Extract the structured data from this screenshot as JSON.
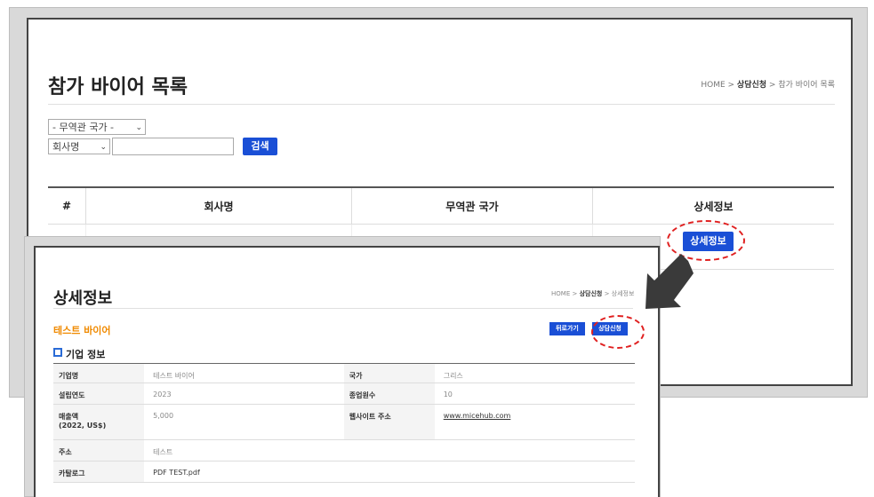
{
  "back": {
    "title": "참가 바이어 목록",
    "breadcrumb": {
      "home": "HOME",
      "sep1": " > ",
      "current": "상담신청",
      "sep2": " > ",
      "page": "참가 바이어 목록"
    },
    "filter": {
      "country_select": "- 무역관 국가 -",
      "field_select": "회사명",
      "search_value": "",
      "search_button": "검색"
    },
    "table": {
      "headers": [
        "#",
        "회사명",
        "무역관 국가",
        "상세정보"
      ],
      "row": {
        "detail_button": "상세정보"
      }
    }
  },
  "front": {
    "title": "상세정보",
    "breadcrumb": {
      "home": "HOME",
      "sep1": " > ",
      "current": "상담신청",
      "sep2": " > ",
      "page": "상세정보"
    },
    "buyer_name": "테스트 바이어",
    "back_button": "뒤로가기",
    "apply_button": "상담신청",
    "section_title": "기업 정보",
    "info": {
      "company_label": "기업명",
      "company_value": "테스트 바이어",
      "country_label": "국가",
      "country_value": "그리스",
      "founded_label": "설립연도",
      "founded_value": "2023",
      "employees_label": "종업원수",
      "employees_value": "10",
      "revenue_label": "매출액\n(2022, US$)",
      "revenue_value": "5,000",
      "website_label": "웹사이트 주소",
      "website_value": "www.micehub.com",
      "address_label": "주소",
      "address_value": "테스트",
      "catalog_label": "카탈로그",
      "catalog_value": "PDF TEST.pdf"
    }
  },
  "colors": {
    "accent_blue": "#1a4fd6",
    "highlight_red": "#e02020",
    "buyer_orange": "#f08a00"
  }
}
